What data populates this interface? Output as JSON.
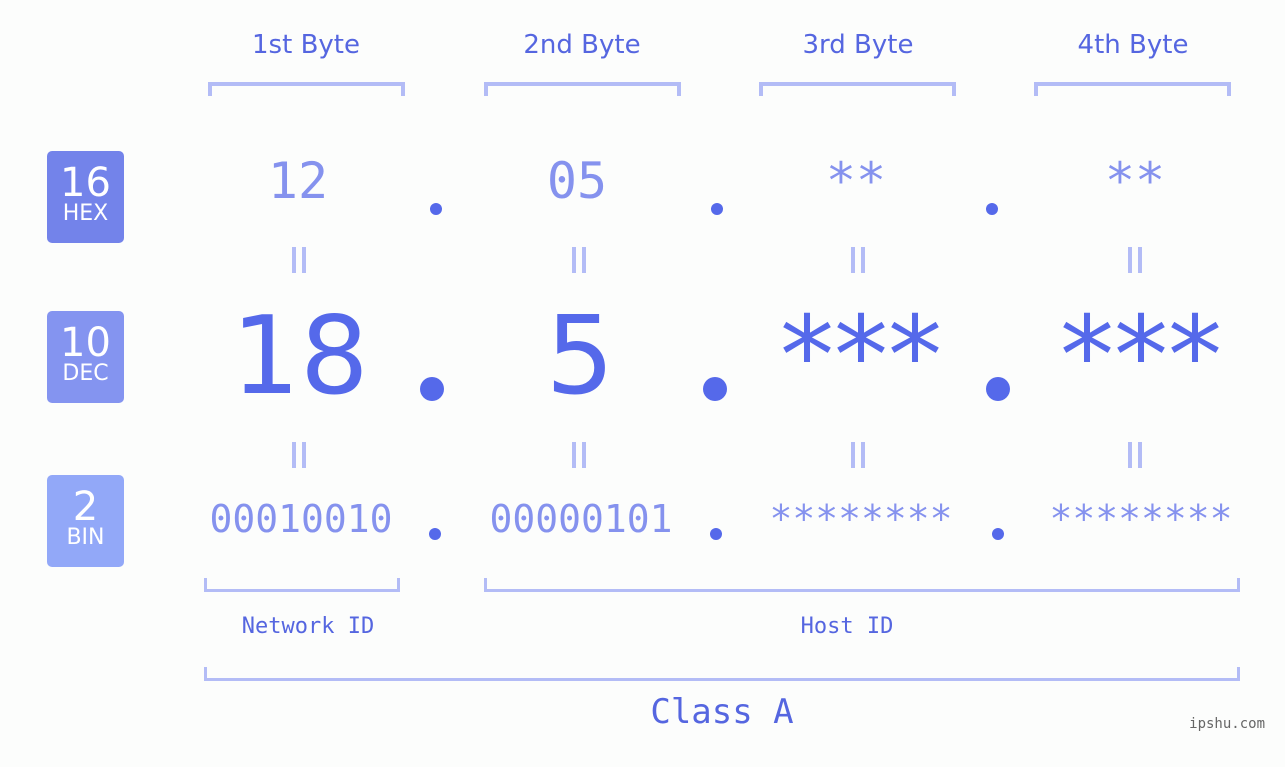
{
  "bytes": [
    {
      "header": "1st Byte",
      "hex": "12",
      "dec": "18",
      "bin": "00010010"
    },
    {
      "header": "2nd Byte",
      "hex": "05",
      "dec": "5",
      "bin": "00000101"
    },
    {
      "header": "3rd Byte",
      "hex": "**",
      "dec": "***",
      "bin": "********"
    },
    {
      "header": "4th Byte",
      "hex": "**",
      "dec": "***",
      "bin": "********"
    }
  ],
  "bases": [
    {
      "number": "16",
      "label": "HEX",
      "color": "#7383ea"
    },
    {
      "number": "10",
      "label": "DEC",
      "color": "#8494f0"
    },
    {
      "number": "2",
      "label": "BIN",
      "color": "#92a8f8"
    }
  ],
  "separator": ".",
  "equals_symbol": "=",
  "network_id_label": "Network ID",
  "host_id_label": "Host ID",
  "class_label": "Class A",
  "watermark": "ipshu.com",
  "colors": {
    "accent": "#5569ea",
    "light_value": "#8592ee",
    "bracket": "#b3bcf6",
    "background": "#fcfdfc"
  }
}
